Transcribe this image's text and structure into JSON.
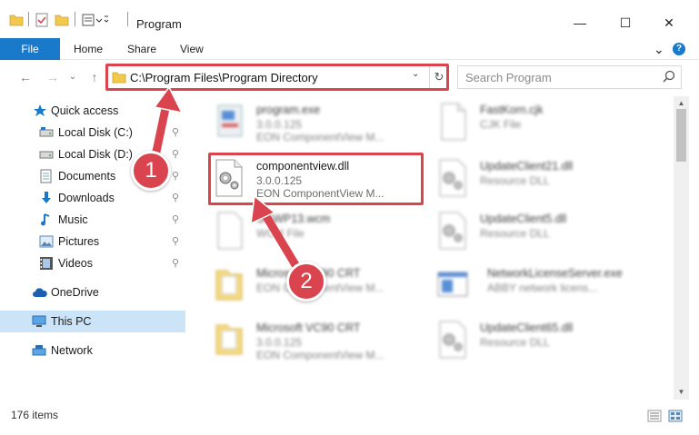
{
  "window": {
    "title": "Program",
    "min_glyph": "—",
    "max_glyph": "☐",
    "close_glyph": "✕"
  },
  "ribbon": {
    "tabs": [
      "File",
      "Home",
      "Share",
      "View"
    ],
    "collapse_glyph": "⌄",
    "help_glyph": "?"
  },
  "address": {
    "path": "C:\\Program Files\\Program Directory",
    "dropdown_glyph": "⌄",
    "refresh_glyph": "↻",
    "back_glyph": "←",
    "forward_glyph": "→",
    "history_glyph": "⌄",
    "up_glyph": "↑"
  },
  "search": {
    "placeholder": "Search Program"
  },
  "sidebar": {
    "items": [
      {
        "label": "Quick access",
        "icon": "star-icon"
      },
      {
        "label": "Local Disk (C:)",
        "icon": "drive-icon",
        "pinned": true
      },
      {
        "label": "Local Disk (D:)",
        "icon": "drive-icon",
        "pinned": true
      },
      {
        "label": "Documents",
        "icon": "documents-icon",
        "pinned": true
      },
      {
        "label": "Downloads",
        "icon": "downloads-icon",
        "pinned": true
      },
      {
        "label": "Music",
        "icon": "music-icon",
        "pinned": true
      },
      {
        "label": "Pictures",
        "icon": "pictures-icon",
        "pinned": true
      },
      {
        "label": "Videos",
        "icon": "videos-icon",
        "pinned": true
      },
      {
        "label": "OneDrive",
        "icon": "cloud-icon"
      },
      {
        "label": "This PC",
        "icon": "computer-icon",
        "selected": true
      },
      {
        "label": "Network",
        "icon": "network-icon"
      }
    ],
    "pin_glyph": "📌"
  },
  "files": [
    {
      "name": "program.exe",
      "line1": "3.0.0.125",
      "line2": "EON ComponentView M...",
      "icon": "exe-icon"
    },
    {
      "name": "FastKorn.cjk",
      "line1": "CJK File",
      "line2": "",
      "icon": "file-icon"
    },
    {
      "name": "componentview.dll",
      "line1": "3.0.0.125",
      "line2": "EON ComponentView M...",
      "icon": "dll-gear-icon",
      "highlighted": true
    },
    {
      "name": "UpdateClient21.dll",
      "line1": "Resource DLL",
      "line2": "",
      "icon": "dll-gear-icon"
    },
    {
      "name": "SGWP13.wcm",
      "line1": "WCM File",
      "line2": "",
      "icon": "file-icon"
    },
    {
      "name": "UpdateClient5.dll",
      "line1": "Resource DLL",
      "line2": "",
      "icon": "dll-gear-icon"
    },
    {
      "name": "Microsoft VC90 CRT",
      "line1": "EON ComponentView M...",
      "line2": "",
      "icon": "folder-icon"
    },
    {
      "name": "NetworkLicenseServer.exe",
      "line1": "ABBY network licens...",
      "line2": "",
      "icon": "app-window-icon"
    },
    {
      "name": "Microsoft VC90 CRT",
      "line1": "3.0.0.125",
      "line2": "EON ComponentView M...",
      "icon": "folder-icon"
    },
    {
      "name": "UpdateClient65.dll",
      "line1": "Resource DLL",
      "line2": "",
      "icon": "dll-gear-icon"
    }
  ],
  "status": {
    "item_count": "176 items"
  },
  "callouts": {
    "step1": "1",
    "step2": "2"
  },
  "colors": {
    "accent": "#1979ca",
    "callout_red": "#d9444e",
    "selection": "#cce4f7"
  }
}
